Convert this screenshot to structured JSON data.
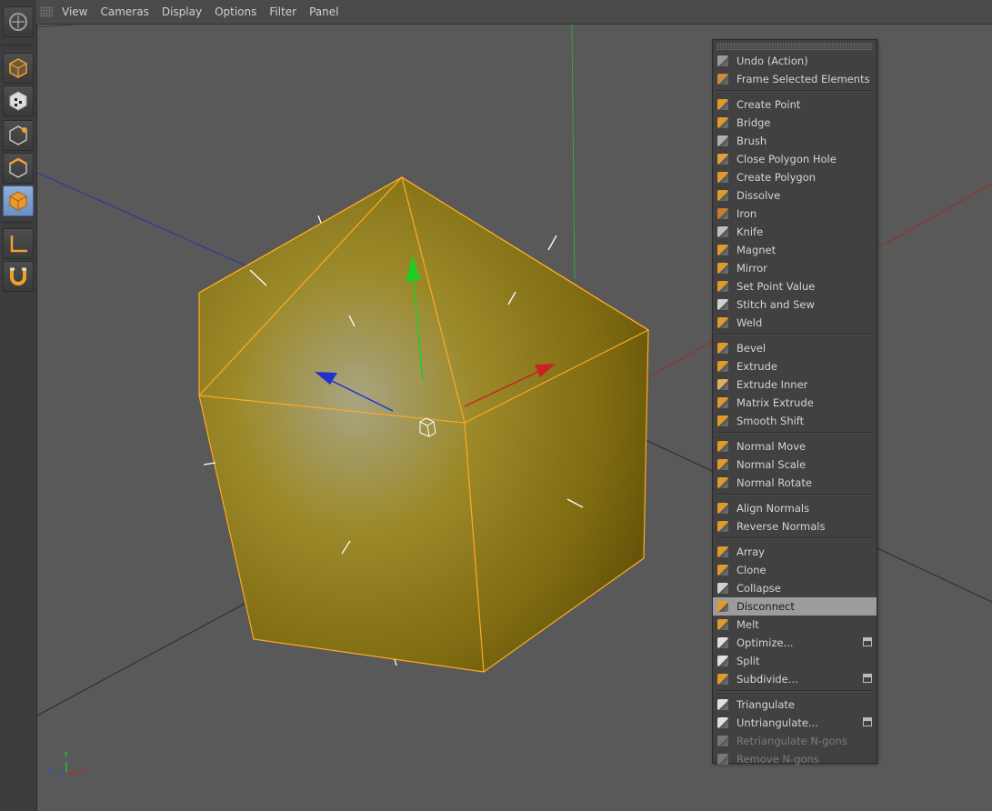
{
  "top_menu": [
    "View",
    "Cameras",
    "Display",
    "Options",
    "Filter",
    "Panel"
  ],
  "toolbar": {
    "tools": [
      {
        "name": "make-editable-icon"
      },
      {
        "name": "model-mode-icon"
      },
      {
        "name": "texture-mode-icon"
      },
      {
        "name": "points-mode-icon"
      },
      {
        "name": "edges-mode-icon"
      },
      {
        "name": "polygons-mode-icon"
      },
      {
        "name": "axis-mode-icon"
      },
      {
        "name": "snapping-icon"
      }
    ]
  },
  "context_menu": {
    "groups": [
      [
        {
          "label": "Undo (Action)",
          "icon": "undo-icon",
          "color": "#9a9a9a"
        },
        {
          "label": "Frame Selected Elements",
          "icon": "frame-selected-icon",
          "color": "#c98a3c"
        }
      ],
      [
        {
          "label": "Create Point",
          "icon": "create-point-icon",
          "color": "#e09a2c"
        },
        {
          "label": "Bridge",
          "icon": "bridge-icon",
          "color": "#e09a2c"
        },
        {
          "label": "Brush",
          "icon": "brush-icon",
          "color": "#b0b0b0"
        },
        {
          "label": "Close Polygon Hole",
          "icon": "close-hole-icon",
          "color": "#e0a040"
        },
        {
          "label": "Create Polygon",
          "icon": "create-polygon-icon",
          "color": "#e09a2c"
        },
        {
          "label": "Dissolve",
          "icon": "dissolve-icon",
          "color": "#e09a2c"
        },
        {
          "label": "Iron",
          "icon": "iron-icon",
          "color": "#c87a30"
        },
        {
          "label": "Knife",
          "icon": "knife-icon",
          "color": "#c0c0c0"
        },
        {
          "label": "Magnet",
          "icon": "magnet-icon",
          "color": "#e09a2c"
        },
        {
          "label": "Mirror",
          "icon": "mirror-icon",
          "color": "#e09a2c"
        },
        {
          "label": "Set Point Value",
          "icon": "set-point-value-icon",
          "color": "#e09a2c"
        },
        {
          "label": "Stitch and Sew",
          "icon": "stitch-sew-icon",
          "color": "#d0d0d0"
        },
        {
          "label": "Weld",
          "icon": "weld-icon",
          "color": "#e09a2c"
        }
      ],
      [
        {
          "label": "Bevel",
          "icon": "bevel-icon",
          "color": "#e09a2c"
        },
        {
          "label": "Extrude",
          "icon": "extrude-icon",
          "color": "#e09a2c"
        },
        {
          "label": "Extrude Inner",
          "icon": "extrude-inner-icon",
          "color": "#e0b060"
        },
        {
          "label": "Matrix Extrude",
          "icon": "matrix-extrude-icon",
          "color": "#e09a2c"
        },
        {
          "label": "Smooth Shift",
          "icon": "smooth-shift-icon",
          "color": "#e09a2c"
        }
      ],
      [
        {
          "label": "Normal Move",
          "icon": "normal-move-icon",
          "color": "#e09a2c"
        },
        {
          "label": "Normal Scale",
          "icon": "normal-scale-icon",
          "color": "#e09a2c"
        },
        {
          "label": "Normal Rotate",
          "icon": "normal-rotate-icon",
          "color": "#e09a2c"
        }
      ],
      [
        {
          "label": "Align Normals",
          "icon": "align-normals-icon",
          "color": "#e09a2c"
        },
        {
          "label": "Reverse Normals",
          "icon": "reverse-normals-icon",
          "color": "#e09a2c"
        }
      ],
      [
        {
          "label": "Array",
          "icon": "array-icon",
          "color": "#e09a2c"
        },
        {
          "label": "Clone",
          "icon": "clone-icon",
          "color": "#e09a2c"
        },
        {
          "label": "Collapse",
          "icon": "collapse-icon",
          "color": "#d0d0d0"
        },
        {
          "label": "Disconnect",
          "icon": "disconnect-icon",
          "color": "#e09a2c",
          "highlight": true
        },
        {
          "label": "Melt",
          "icon": "melt-icon",
          "color": "#e09a2c"
        },
        {
          "label": "Optimize...",
          "icon": "optimize-icon",
          "color": "#e0e0e0",
          "options": true
        },
        {
          "label": "Split",
          "icon": "split-icon",
          "color": "#e0e0e0"
        },
        {
          "label": "Subdivide...",
          "icon": "subdivide-icon",
          "color": "#e09a2c",
          "options": true
        }
      ],
      [
        {
          "label": "Triangulate",
          "icon": "triangulate-icon",
          "color": "#e0e0e0"
        },
        {
          "label": "Untriangulate...",
          "icon": "untriangulate-icon",
          "color": "#e0e0e0",
          "options": true
        },
        {
          "label": "Retriangulate N-gons",
          "icon": "retriangulate-icon",
          "color": "#777777",
          "disabled": true
        },
        {
          "label": "Remove N-gons",
          "icon": "remove-ngons-icon",
          "color": "#777777",
          "disabled": true
        }
      ]
    ]
  },
  "viewport": {
    "axis_labels": {
      "x": "X",
      "y": "Y",
      "z": "Z"
    },
    "colors": {
      "x_axis": "#cc2222",
      "y_axis": "#22cc22",
      "z_axis": "#2233cc",
      "mesh": "#b8a020",
      "edge": "#ffaa22"
    }
  }
}
